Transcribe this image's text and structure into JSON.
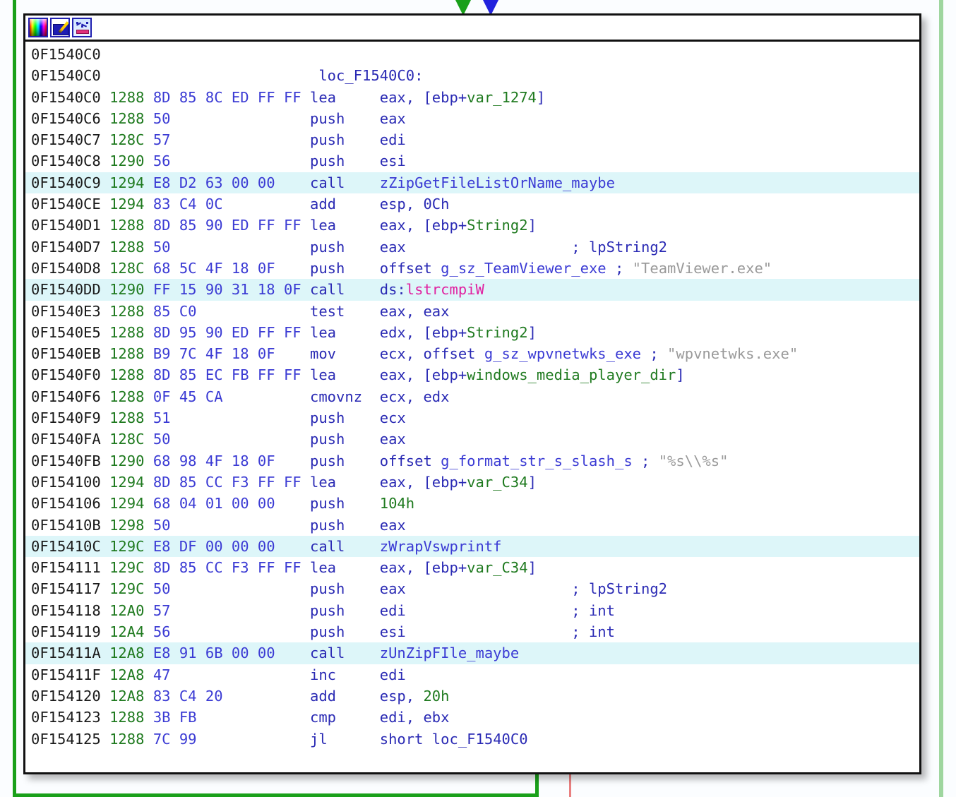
{
  "view": {
    "kind": "ida-graph-node",
    "block_label": "loc_F1540C0",
    "highlight_color": "#ddf6f9",
    "node_border_color": "#111111",
    "background_color": "#fbfdff"
  },
  "toolbar": {
    "buttons": [
      {
        "name": "palette-icon",
        "tooltip": "Color palette"
      },
      {
        "name": "edit-image-icon",
        "tooltip": "Edit"
      },
      {
        "name": "graph-icon",
        "tooltip": "Graph"
      }
    ]
  },
  "edges": {
    "incoming": [
      {
        "name": "incoming-edge-green",
        "color": "#1aa01a"
      },
      {
        "name": "incoming-edge-blue",
        "color": "#2222dd"
      }
    ],
    "outgoing": [
      {
        "name": "loop-back-edge-green",
        "color": "#1aa01a"
      },
      {
        "name": "fallthrough-edge-red",
        "color": "#e98080"
      }
    ]
  },
  "listing": {
    "rows": [
      {
        "addr": "0F1540C0",
        "stack": "",
        "bytes": "",
        "mnem": "",
        "oper": "",
        "highlight": false,
        "label": ""
      },
      {
        "addr": "0F1540C0",
        "stack": "",
        "bytes": "",
        "mnem": "",
        "oper": "",
        "highlight": false,
        "label": "loc_F1540C0:"
      },
      {
        "addr": "0F1540C0",
        "stack": "1288",
        "bytes": "8D 85 8C ED FF FF",
        "mnem": "lea",
        "oper": "eax, [ebp+var_1274]",
        "highlight": false,
        "var": "var_1274"
      },
      {
        "addr": "0F1540C6",
        "stack": "1288",
        "bytes": "50",
        "mnem": "push",
        "oper": "eax",
        "highlight": false
      },
      {
        "addr": "0F1540C7",
        "stack": "128C",
        "bytes": "57",
        "mnem": "push",
        "oper": "edi",
        "highlight": false
      },
      {
        "addr": "0F1540C8",
        "stack": "1290",
        "bytes": "56",
        "mnem": "push",
        "oper": "esi",
        "highlight": false
      },
      {
        "addr": "0F1540C9",
        "stack": "1294",
        "bytes": "E8 D2 63 00 00",
        "mnem": "call",
        "oper": "zZipGetFileListOrName_maybe",
        "highlight": true
      },
      {
        "addr": "0F1540CE",
        "stack": "1294",
        "bytes": "83 C4 0C",
        "mnem": "add",
        "oper": "esp, 0Ch",
        "highlight": false
      },
      {
        "addr": "0F1540D1",
        "stack": "1288",
        "bytes": "8D 85 90 ED FF FF",
        "mnem": "lea",
        "oper": "eax, [ebp+String2]",
        "highlight": false,
        "var": "String2"
      },
      {
        "addr": "0F1540D7",
        "stack": "1288",
        "bytes": "50",
        "mnem": "push",
        "oper": "eax",
        "highlight": false,
        "arg_comment": "; lpString2"
      },
      {
        "addr": "0F1540D8",
        "stack": "128C",
        "bytes": "68 5C 4F 18 0F",
        "mnem": "push",
        "oper": "offset g_sz_TeamViewer_exe",
        "highlight": false,
        "str_comment": "; \"TeamViewer.exe\""
      },
      {
        "addr": "0F1540DD",
        "stack": "1290",
        "bytes": "FF 15 90 31 18 0F",
        "mnem": "call",
        "oper": "ds:lstrcmpiW",
        "highlight": true,
        "api": "lstrcmpiW"
      },
      {
        "addr": "0F1540E3",
        "stack": "1288",
        "bytes": "85 C0",
        "mnem": "test",
        "oper": "eax, eax",
        "highlight": false
      },
      {
        "addr": "0F1540E5",
        "stack": "1288",
        "bytes": "8D 95 90 ED FF FF",
        "mnem": "lea",
        "oper": "edx, [ebp+String2]",
        "highlight": false,
        "var": "String2"
      },
      {
        "addr": "0F1540EB",
        "stack": "1288",
        "bytes": "B9 7C 4F 18 0F",
        "mnem": "mov",
        "oper": "ecx, offset g_sz_wpvnetwks_exe",
        "highlight": false,
        "str_comment": "; \"wpvnetwks.exe\""
      },
      {
        "addr": "0F1540F0",
        "stack": "1288",
        "bytes": "8D 85 EC FB FF FF",
        "mnem": "lea",
        "oper": "eax, [ebp+windows_media_player_dir]",
        "highlight": false,
        "var": "windows_media_player_dir"
      },
      {
        "addr": "0F1540F6",
        "stack": "1288",
        "bytes": "0F 45 CA",
        "mnem": "cmovnz",
        "oper": "ecx, edx",
        "highlight": false
      },
      {
        "addr": "0F1540F9",
        "stack": "1288",
        "bytes": "51",
        "mnem": "push",
        "oper": "ecx",
        "highlight": false
      },
      {
        "addr": "0F1540FA",
        "stack": "128C",
        "bytes": "50",
        "mnem": "push",
        "oper": "eax",
        "highlight": false
      },
      {
        "addr": "0F1540FB",
        "stack": "1290",
        "bytes": "68 98 4F 18 0F",
        "mnem": "push",
        "oper": "offset g_format_str_s_slash_s",
        "highlight": false,
        "str_comment": "; \"%s\\\\%s\""
      },
      {
        "addr": "0F154100",
        "stack": "1294",
        "bytes": "8D 85 CC F3 FF FF",
        "mnem": "lea",
        "oper": "eax, [ebp+var_C34]",
        "highlight": false,
        "var": "var_C34"
      },
      {
        "addr": "0F154106",
        "stack": "1294",
        "bytes": "68 04 01 00 00",
        "mnem": "push",
        "oper": "104h",
        "highlight": false,
        "imm": "104h"
      },
      {
        "addr": "0F15410B",
        "stack": "1298",
        "bytes": "50",
        "mnem": "push",
        "oper": "eax",
        "highlight": false
      },
      {
        "addr": "0F15410C",
        "stack": "129C",
        "bytes": "E8 DF 00 00 00",
        "mnem": "call",
        "oper": "zWrapVswprintf",
        "highlight": true
      },
      {
        "addr": "0F154111",
        "stack": "129C",
        "bytes": "8D 85 CC F3 FF FF",
        "mnem": "lea",
        "oper": "eax, [ebp+var_C34]",
        "highlight": false,
        "var": "var_C34"
      },
      {
        "addr": "0F154117",
        "stack": "129C",
        "bytes": "50",
        "mnem": "push",
        "oper": "eax",
        "highlight": false,
        "arg_comment": "; lpString2"
      },
      {
        "addr": "0F154118",
        "stack": "12A0",
        "bytes": "57",
        "mnem": "push",
        "oper": "edi",
        "highlight": false,
        "arg_comment": "; int"
      },
      {
        "addr": "0F154119",
        "stack": "12A4",
        "bytes": "56",
        "mnem": "push",
        "oper": "esi",
        "highlight": false,
        "arg_comment": "; int"
      },
      {
        "addr": "0F15411A",
        "stack": "12A8",
        "bytes": "E8 91 6B 00 00",
        "mnem": "call",
        "oper": "zUnZipFIle_maybe",
        "highlight": true
      },
      {
        "addr": "0F15411F",
        "stack": "12A8",
        "bytes": "47",
        "mnem": "inc",
        "oper": "edi",
        "highlight": false
      },
      {
        "addr": "0F154120",
        "stack": "12A8",
        "bytes": "83 C4 20",
        "mnem": "add",
        "oper": "esp, 20h",
        "highlight": false,
        "imm": "20h"
      },
      {
        "addr": "0F154123",
        "stack": "1288",
        "bytes": "3B FB",
        "mnem": "cmp",
        "oper": "edi, ebx",
        "highlight": false
      },
      {
        "addr": "0F154125",
        "stack": "1288",
        "bytes": "7C 99",
        "mnem": "jl",
        "oper": "short loc_F1540C0",
        "highlight": false,
        "label_ref": "loc_F1540C0"
      }
    ]
  }
}
